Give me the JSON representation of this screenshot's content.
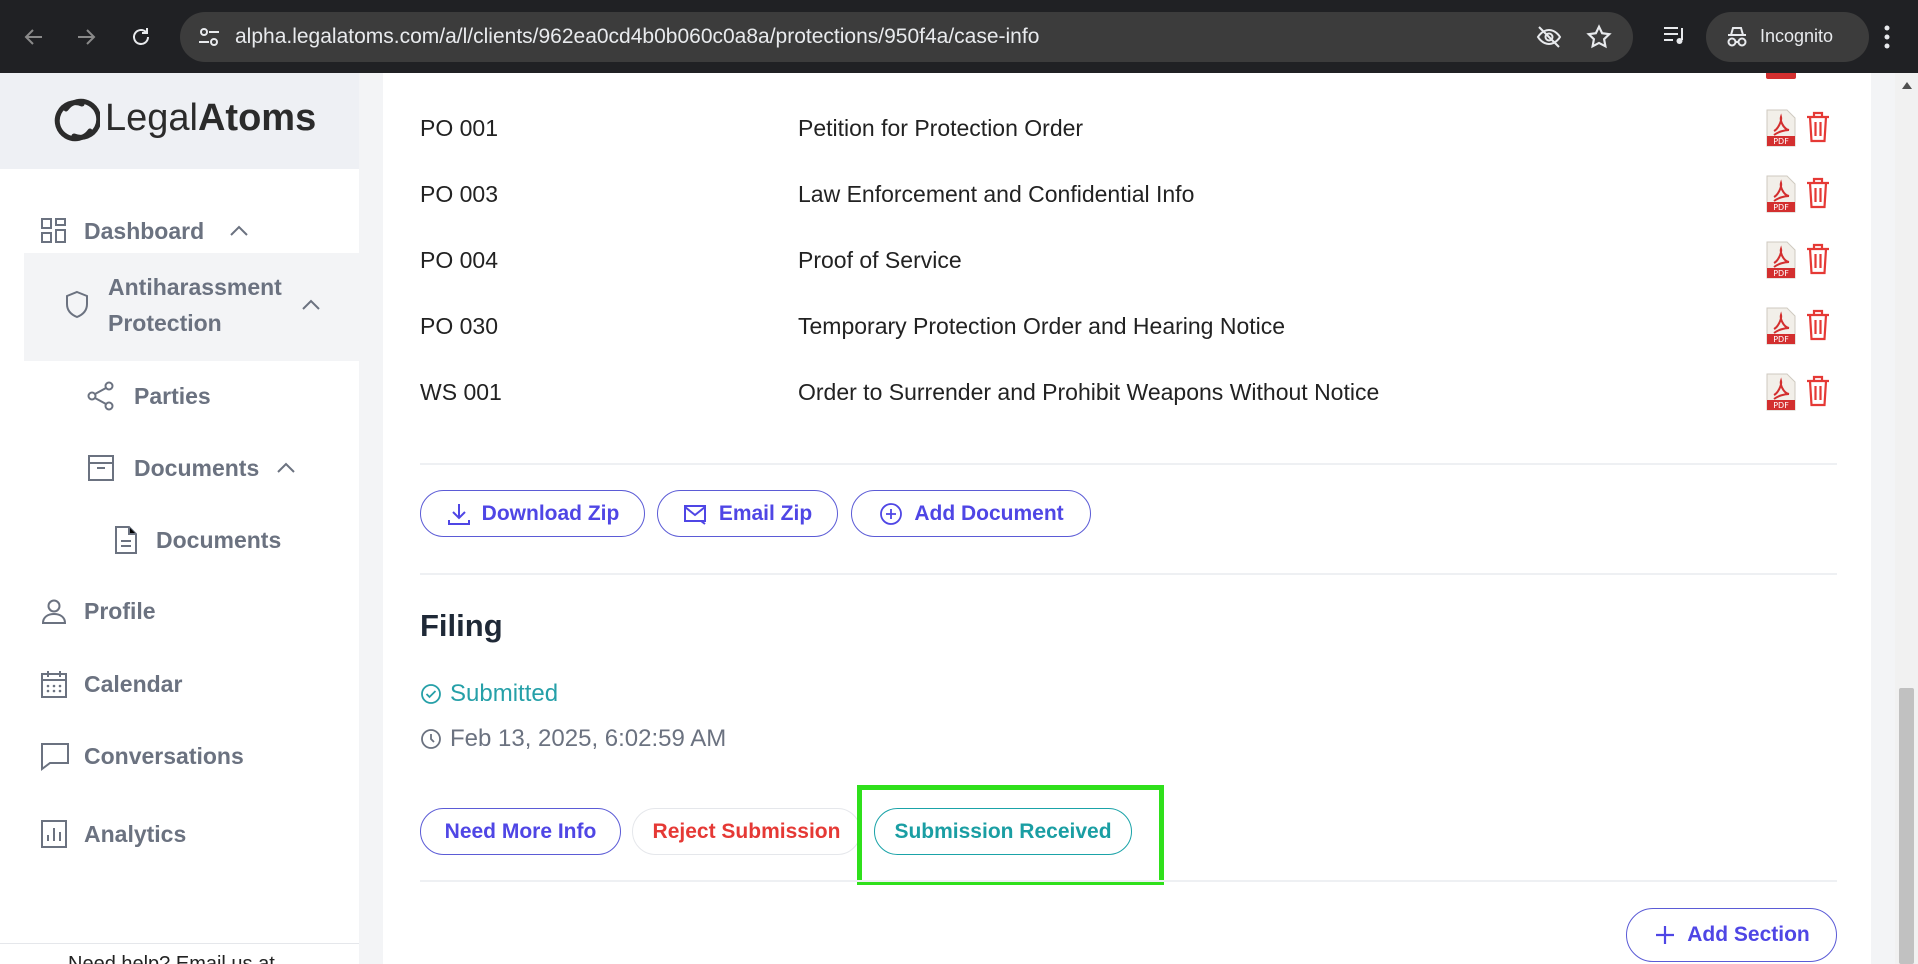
{
  "browser": {
    "url": "alpha.legalatoms.com/a/l/clients/962ea0cd4b0b060c0a8a/protections/950f4a/case-info",
    "profile_label": "Incognito"
  },
  "sidebar": {
    "logo_text_light": "Legal",
    "logo_text_bold": "Atoms",
    "items": {
      "dashboard": "Dashboard",
      "antiharassment_line1": "Antiharassment",
      "antiharassment_line2": "Protection",
      "parties": "Parties",
      "documents_group": "Documents",
      "documents_sub": "Documents",
      "profile": "Profile",
      "calendar": "Calendar",
      "conversations": "Conversations",
      "analytics": "Analytics"
    },
    "help_text": "Need help? Email us at"
  },
  "documents": {
    "rows": [
      {
        "code": "PO 001",
        "name": "Petition for Protection Order"
      },
      {
        "code": "PO 003",
        "name": "Law Enforcement and Confidential Info"
      },
      {
        "code": "PO 004",
        "name": "Proof of Service"
      },
      {
        "code": "PO 030",
        "name": "Temporary Protection Order and Hearing Notice"
      },
      {
        "code": "WS 001",
        "name": "Order to Surrender and Prohibit Weapons Without Notice"
      }
    ],
    "pdf_badge": "PDF",
    "actions": {
      "download_zip": "Download Zip",
      "email_zip": "Email Zip",
      "add_document": "Add Document"
    }
  },
  "filing": {
    "title": "Filing",
    "status": "Submitted",
    "timestamp": "Feb 13, 2025, 6:02:59 AM",
    "actions": {
      "need_more_info": "Need More Info",
      "reject_submission": "Reject Submission",
      "submission_received": "Submission Received"
    }
  },
  "footer_actions": {
    "add_section": "Add Section"
  },
  "colors": {
    "accent": "#4f46e5",
    "danger": "#e53935",
    "teal": "#1a9ea3",
    "highlight": "#2fe01b"
  }
}
